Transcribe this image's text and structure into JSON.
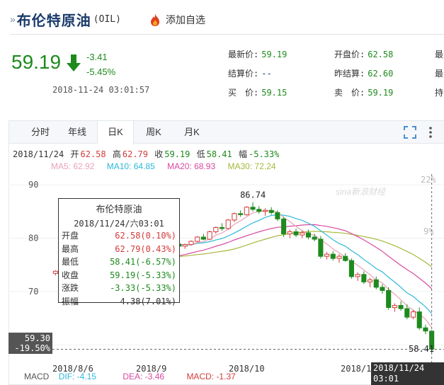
{
  "header": {
    "title": "布伦特原油",
    "code": "(OIL)",
    "fav_label": "添加自选"
  },
  "quote": {
    "price": "59.19",
    "change": "-3.41",
    "change_pct": "-5.45%",
    "time": "2018-11-24 03:01:57",
    "col1": [
      {
        "label": "最新价:",
        "value": "59.19"
      },
      {
        "label": "结算价:",
        "value": "--"
      },
      {
        "label": "买　价:",
        "value": "59.15"
      }
    ],
    "col2": [
      {
        "label": "开盘价:",
        "value": "62.58"
      },
      {
        "label": "昨结算:",
        "value": "62.60"
      },
      {
        "label": "卖　价:",
        "value": "59.19"
      }
    ],
    "col3_labels": [
      "最",
      "最",
      "持"
    ]
  },
  "tabs": [
    "分时",
    "年线",
    "日K",
    "周K",
    "月K"
  ],
  "active_tab": "日K",
  "ohlc": {
    "date": "2018/11/24",
    "open_label": "开",
    "open": "62.58",
    "high_label": "高",
    "high": "62.79",
    "close_label": "收",
    "close": "59.19",
    "low_label": "低",
    "low": "58.41",
    "amp_label": "幅",
    "amp": "-5.33%"
  },
  "ma": {
    "ma5": "MA5: 62.92",
    "ma10": "MA10: 64.85",
    "ma20": "MA20: 68.93",
    "ma30": "MA30: 72.24"
  },
  "colors": {
    "up": "#d43b3b",
    "down": "#1e8a1e",
    "ma5": "#e8a3b8",
    "ma10": "#2fb8d8",
    "ma20": "#d94aa0",
    "ma30": "#a8b83a"
  },
  "tooltip": {
    "title": "布伦特原油",
    "date": "2018/11/24/六03:01",
    "rows": [
      {
        "label": "开盘",
        "value": "62.58(0.10%)",
        "color": "red"
      },
      {
        "label": "最高",
        "value": "62.79(0.43%)",
        "color": "red"
      },
      {
        "label": "最低",
        "value": "58.41(-6.57%)",
        "color": "green"
      },
      {
        "label": "收盘",
        "value": "59.19(-5.33%)",
        "color": "green"
      },
      {
        "label": "涨跌",
        "value": "-3.33(-5.33%)",
        "color": "green"
      },
      {
        "label": "振幅",
        "value": "4.38(7.01%)",
        "color": "dark"
      }
    ]
  },
  "axis": {
    "y_left": [
      "90",
      "80",
      "70",
      "60"
    ],
    "y_right": [
      "22%",
      "9%"
    ],
    "x_labels": [
      "2018/8/6",
      "2018/9",
      "2018/10",
      "2018/1"
    ],
    "high_marker": "86.74",
    "low_marker": "58.41",
    "left_price": "59.30",
    "left_pct": "-19.50%",
    "date_badge": "2018/11/24 03:01"
  },
  "watermark": "sina新浪财经",
  "macd": {
    "label": "MACD",
    "dif": "DIF: -4.15",
    "dea": "DEA: -3.46",
    "macd": "MACD: -1.37"
  },
  "chart_data": {
    "type": "candlestick",
    "ylim": [
      57,
      92
    ],
    "candles": [
      [
        73.4,
        74.0,
        73.0,
        73.8
      ],
      [
        73.8,
        74.6,
        73.4,
        74.2
      ],
      [
        74.2,
        74.8,
        73.8,
        73.6
      ],
      [
        73.6,
        74.4,
        73.2,
        74.3
      ],
      [
        74.3,
        75.0,
        74.0,
        74.8
      ],
      [
        74.8,
        75.2,
        74.0,
        74.2
      ],
      [
        74.2,
        74.8,
        73.6,
        74.6
      ],
      [
        74.6,
        75.4,
        74.2,
        75.2
      ],
      [
        75.2,
        76.0,
        74.8,
        75.6
      ],
      [
        75.6,
        76.2,
        75.0,
        75.2
      ],
      [
        75.2,
        77.0,
        75.0,
        76.8
      ],
      [
        76.8,
        77.8,
        76.4,
        77.4
      ],
      [
        77.4,
        78.4,
        77.0,
        78.2
      ],
      [
        78.2,
        78.8,
        77.6,
        77.8
      ],
      [
        77.8,
        79.0,
        77.4,
        78.8
      ],
      [
        78.8,
        79.6,
        78.2,
        79.2
      ],
      [
        79.2,
        79.8,
        78.6,
        78.8
      ],
      [
        78.8,
        79.4,
        78.2,
        79.2
      ],
      [
        79.2,
        79.6,
        78.4,
        78.6
      ],
      [
        78.6,
        79.2,
        78.0,
        78.9
      ],
      [
        78.9,
        79.4,
        78.4,
        78.5
      ],
      [
        78.5,
        79.0,
        78.0,
        78.8
      ],
      [
        78.8,
        79.6,
        78.6,
        79.4
      ],
      [
        79.4,
        80.4,
        79.2,
        80.2
      ],
      [
        80.2,
        80.8,
        79.6,
        79.8
      ],
      [
        79.8,
        81.4,
        79.6,
        81.2
      ],
      [
        81.2,
        82.2,
        80.8,
        82.0
      ],
      [
        82.0,
        82.8,
        81.4,
        81.8
      ],
      [
        81.8,
        83.6,
        81.6,
        83.4
      ],
      [
        83.4,
        84.8,
        83.0,
        84.6
      ],
      [
        84.6,
        85.2,
        84.0,
        84.4
      ],
      [
        84.4,
        86.0,
        84.2,
        85.8
      ],
      [
        85.8,
        86.74,
        85.0,
        85.4
      ],
      [
        85.4,
        86.0,
        84.6,
        85.0
      ],
      [
        85.0,
        85.6,
        84.2,
        85.2
      ],
      [
        85.2,
        85.8,
        84.4,
        84.8
      ],
      [
        84.8,
        85.2,
        83.2,
        83.6
      ],
      [
        83.6,
        84.0,
        80.2,
        80.8
      ],
      [
        80.8,
        81.6,
        80.0,
        81.2
      ],
      [
        81.2,
        81.8,
        80.2,
        80.6
      ],
      [
        80.6,
        81.4,
        80.0,
        81.0
      ],
      [
        81.0,
        81.6,
        79.8,
        80.2
      ],
      [
        80.2,
        80.8,
        79.4,
        79.8
      ],
      [
        79.8,
        80.4,
        76.2,
        76.6
      ],
      [
        76.6,
        77.4,
        76.0,
        77.0
      ],
      [
        77.0,
        77.6,
        75.8,
        76.2
      ],
      [
        76.2,
        77.0,
        75.4,
        76.6
      ],
      [
        76.6,
        77.2,
        75.6,
        75.8
      ],
      [
        75.8,
        76.2,
        72.4,
        72.8
      ],
      [
        72.8,
        73.6,
        72.0,
        73.2
      ],
      [
        73.2,
        73.8,
        71.4,
        71.8
      ],
      [
        71.8,
        72.6,
        70.8,
        72.2
      ],
      [
        72.2,
        72.8,
        70.4,
        70.8
      ],
      [
        70.8,
        71.4,
        69.6,
        70.2
      ],
      [
        70.2,
        70.8,
        66.6,
        67.0
      ],
      [
        67.0,
        67.8,
        66.2,
        67.4
      ],
      [
        67.4,
        68.2,
        66.4,
        66.8
      ],
      [
        66.8,
        67.6,
        64.8,
        65.2
      ],
      [
        65.2,
        66.6,
        64.8,
        66.2
      ],
      [
        66.2,
        67.0,
        62.8,
        63.2
      ],
      [
        63.2,
        63.8,
        62.0,
        62.6
      ],
      [
        62.58,
        62.79,
        58.41,
        59.19
      ]
    ]
  }
}
